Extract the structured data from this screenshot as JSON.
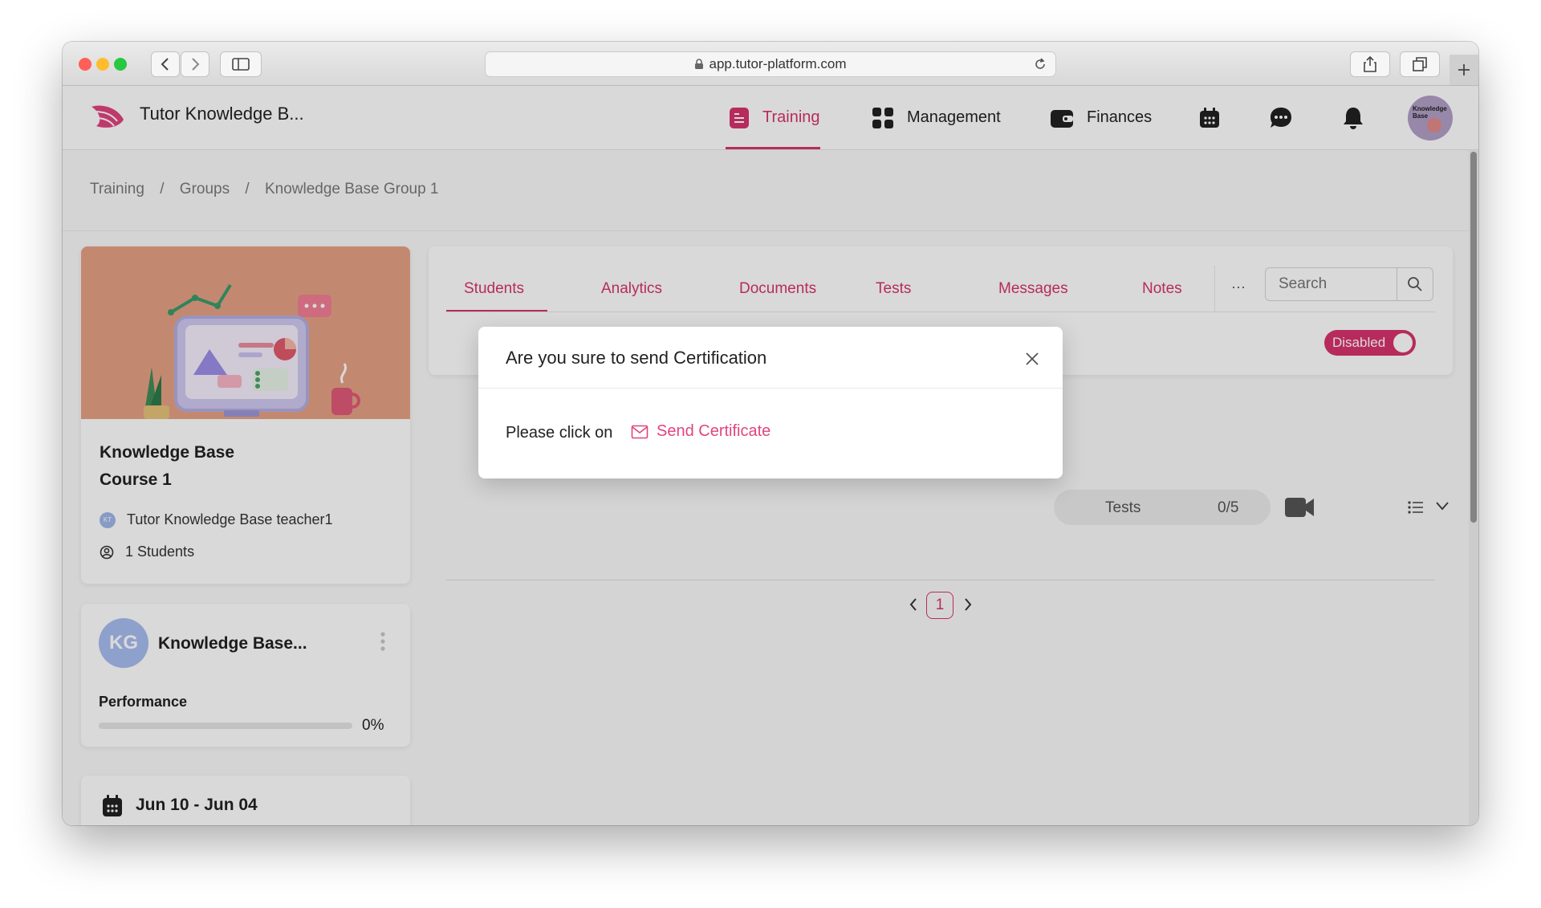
{
  "browser": {
    "url": "app.tutor-platform.com"
  },
  "header": {
    "brand": "Tutor Knowledge B...",
    "nav": [
      {
        "label": "Training",
        "active": true
      },
      {
        "label": "Management",
        "active": false
      },
      {
        "label": "Finances",
        "active": false
      }
    ],
    "avatar_text": "Knowledge Base"
  },
  "breadcrumb": [
    "Training",
    "/",
    "Groups",
    "/",
    "Knowledge Base Group 1"
  ],
  "course": {
    "title_line1": "Knowledge Base",
    "title_line2": "Course 1",
    "teacher_initials": "KT",
    "teacher": "Tutor Knowledge Base teacher1",
    "students": "1 Students"
  },
  "group": {
    "initials": "KG",
    "name": "Knowledge Base...",
    "performance_label": "Performance",
    "performance_value": "0%",
    "performance_fraction": 0
  },
  "dates": {
    "range": "Jun 10 - Jun 04"
  },
  "tabs": [
    {
      "label": "Students",
      "active": true
    },
    {
      "label": "Analytics",
      "active": false
    },
    {
      "label": "Documents",
      "active": false
    },
    {
      "label": "Tests",
      "active": false
    },
    {
      "label": "Messages",
      "active": false
    },
    {
      "label": "Notes",
      "active": false
    }
  ],
  "more_label": "···",
  "search": {
    "placeholder": "Search"
  },
  "toggle": {
    "label": "Disabled"
  },
  "student_row": {
    "tests_label": "Tests",
    "tests_value": "0/5"
  },
  "pagination": {
    "current": "1"
  },
  "modal": {
    "title": "Are you sure to send Certification",
    "body_prefix": "Please click on",
    "link_label": "Send Certificate"
  },
  "colors": {
    "accent": "#d8336d",
    "accent_light": "#f06a9e"
  }
}
